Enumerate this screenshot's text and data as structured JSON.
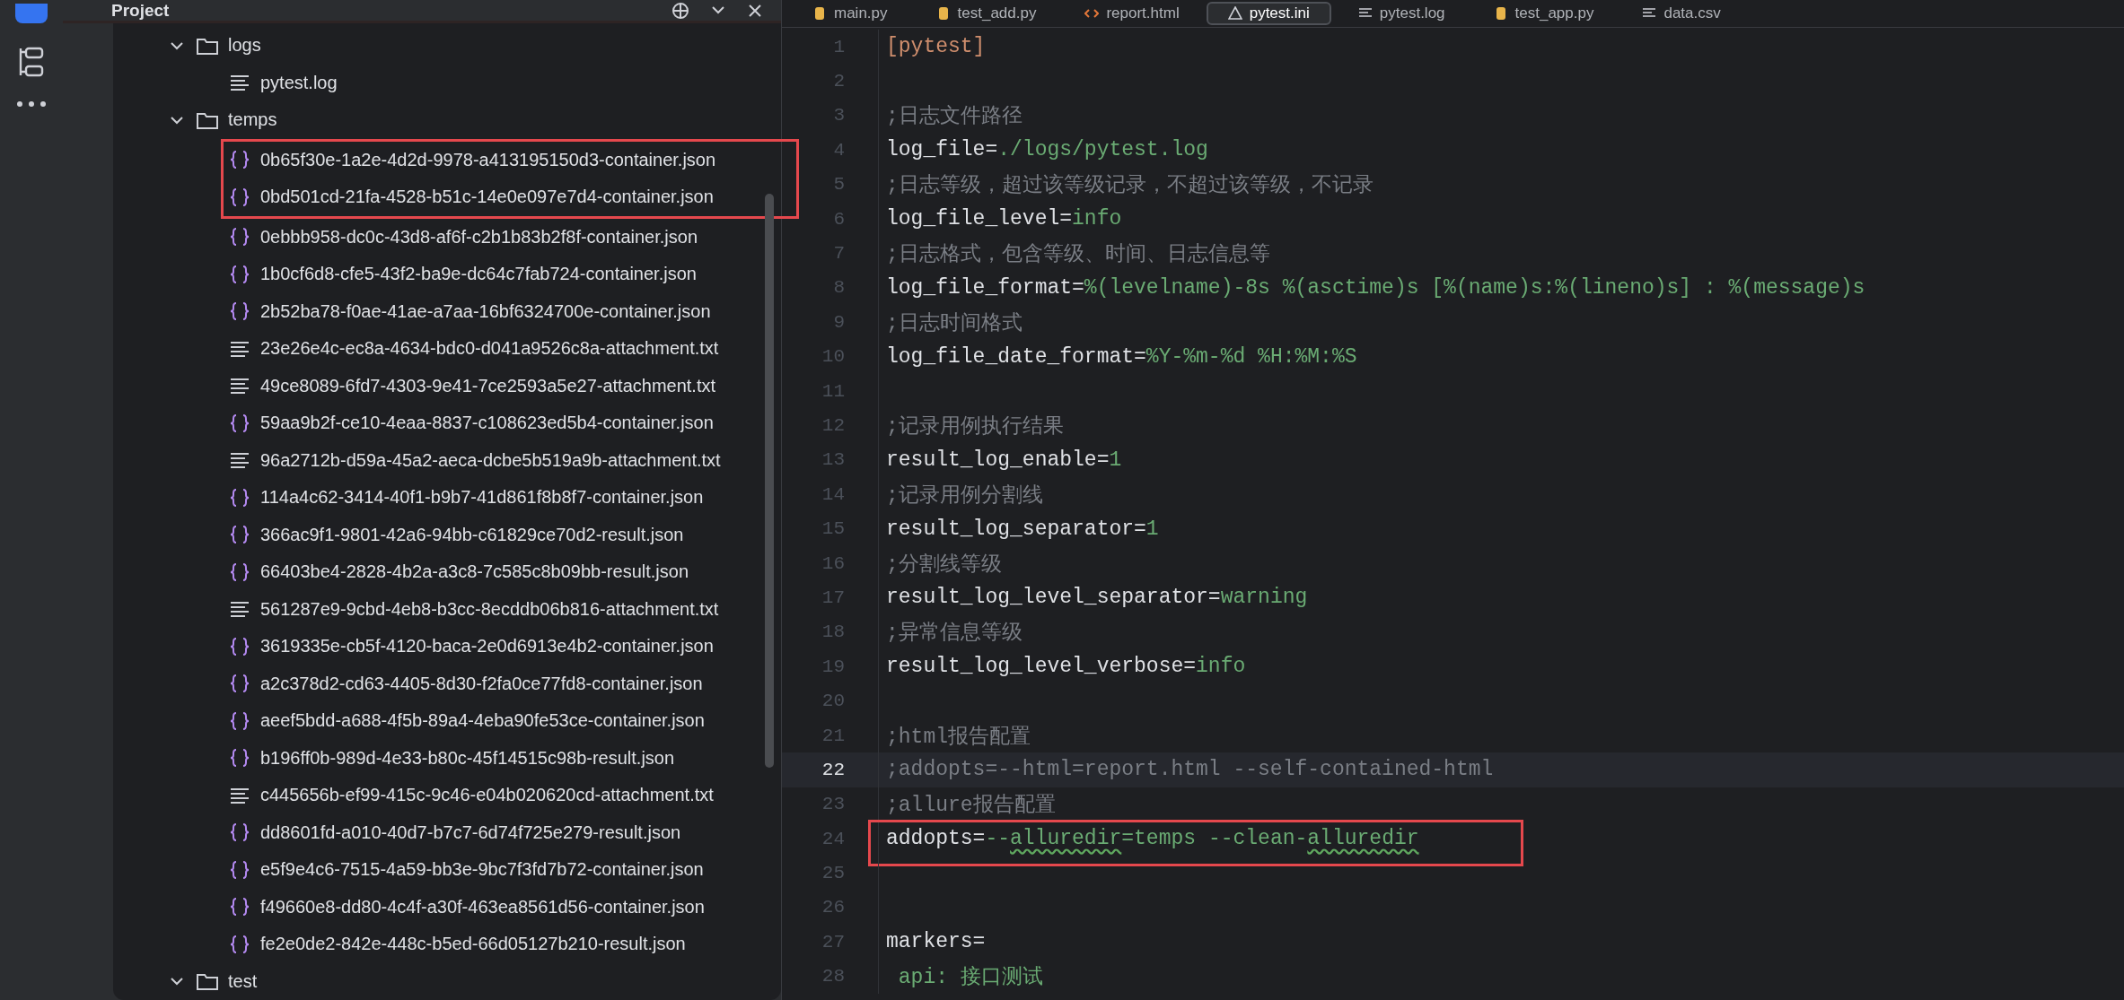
{
  "project_panel": {
    "title": "Project",
    "tree": [
      {
        "name": "logs",
        "kind": "folder",
        "expanded": true,
        "children": [
          {
            "name": "pytest.log",
            "kind": "text",
            "highlighted": false
          }
        ]
      },
      {
        "name": "temps",
        "kind": "folder",
        "expanded": true,
        "children": [
          {
            "name": "0b65f30e-1a2e-4d2d-9978-a413195150d3-container.json",
            "kind": "json",
            "highlighted": true
          },
          {
            "name": "0bd501cd-21fa-4528-b51c-14e0e097e7d4-container.json",
            "kind": "json",
            "highlighted": true
          },
          {
            "name": "0ebbb958-dc0c-43d8-af6f-c2b1b83b2f8f-container.json",
            "kind": "json",
            "highlighted": false
          },
          {
            "name": "1b0cf6d8-cfe5-43f2-ba9e-dc64c7fab724-container.json",
            "kind": "json",
            "highlighted": false
          },
          {
            "name": "2b52ba78-f0ae-41ae-a7aa-16bf6324700e-container.json",
            "kind": "json",
            "highlighted": false
          },
          {
            "name": "23e26e4c-ec8a-4634-bdc0-d041a9526c8a-attachment.txt",
            "kind": "text",
            "highlighted": false
          },
          {
            "name": "49ce8089-6fd7-4303-9e41-7ce2593a5e27-attachment.txt",
            "kind": "text",
            "highlighted": false
          },
          {
            "name": "59aa9b2f-ce10-4eaa-8837-c108623ed5b4-container.json",
            "kind": "json",
            "highlighted": false
          },
          {
            "name": "96a2712b-d59a-45a2-aeca-dcbe5b519a9b-attachment.txt",
            "kind": "text",
            "highlighted": false
          },
          {
            "name": "114a4c62-3414-40f1-b9b7-41d861f8b8f7-container.json",
            "kind": "json",
            "highlighted": false
          },
          {
            "name": "366ac9f1-9801-42a6-94bb-c61829ce70d2-result.json",
            "kind": "json",
            "highlighted": false
          },
          {
            "name": "66403be4-2828-4b2a-a3c8-7c585c8b09bb-result.json",
            "kind": "json",
            "highlighted": false
          },
          {
            "name": "561287e9-9cbd-4eb8-b3cc-8ecddb06b816-attachment.txt",
            "kind": "text",
            "highlighted": false
          },
          {
            "name": "3619335e-cb5f-4120-baca-2e0d6913e4b2-container.json",
            "kind": "json",
            "highlighted": false
          },
          {
            "name": "a2c378d2-cd63-4405-8d30-f2fa0ce77fd8-container.json",
            "kind": "json",
            "highlighted": false
          },
          {
            "name": "aeef5bdd-a688-4f5b-89a4-4eba90fe53ce-container.json",
            "kind": "json",
            "highlighted": false
          },
          {
            "name": "b196ff0b-989d-4e33-b80c-45f14515c98b-result.json",
            "kind": "json",
            "highlighted": false
          },
          {
            "name": "c445656b-ef99-415c-9c46-e04b020620cd-attachment.txt",
            "kind": "text",
            "highlighted": false
          },
          {
            "name": "dd8601fd-a010-40d7-b7c7-6d74f725e279-result.json",
            "kind": "json",
            "highlighted": false
          },
          {
            "name": "e5f9e4c6-7515-4a59-bb3e-9bc7f3fd7b72-container.json",
            "kind": "json",
            "highlighted": false
          },
          {
            "name": "f49660e8-dd80-4c4f-a30f-463ea8561d56-container.json",
            "kind": "json",
            "highlighted": false
          },
          {
            "name": "fe2e0de2-842e-448c-b5ed-66d05127b210-result.json",
            "kind": "json",
            "highlighted": false
          }
        ]
      },
      {
        "name": "test",
        "kind": "folder",
        "expanded": true
      }
    ]
  },
  "editor": {
    "tabs": [
      {
        "label": "main.py",
        "kind": "python",
        "selected": false
      },
      {
        "label": "test_add.py",
        "kind": "python",
        "selected": false
      },
      {
        "label": "report.html",
        "kind": "html",
        "selected": false
      },
      {
        "label": "pytest.ini",
        "kind": "ini",
        "selected": true
      },
      {
        "label": "pytest.log",
        "kind": "text",
        "selected": false
      },
      {
        "label": "test_app.py",
        "kind": "python",
        "selected": false
      },
      {
        "label": "data.csv",
        "kind": "text",
        "selected": false
      }
    ],
    "lines": [
      {
        "number": "1",
        "current": false,
        "highlighted": false,
        "segments": [
          {
            "text": "[pytest]",
            "kind": "section"
          }
        ]
      },
      {
        "number": "2",
        "current": false,
        "highlighted": false
      },
      {
        "number": "3",
        "current": false,
        "highlighted": false,
        "segments": [
          {
            "text": ";日志文件路径",
            "kind": "comment"
          }
        ]
      },
      {
        "number": "4",
        "current": false,
        "highlighted": false,
        "segments": [
          {
            "text": "log_file=",
            "kind": "key"
          },
          {
            "text": "./logs/pytest.log",
            "kind": "value"
          }
        ]
      },
      {
        "number": "5",
        "current": false,
        "highlighted": false,
        "segments": [
          {
            "text": ";日志等级，超过该等级记录，不超过该等级，不记录",
            "kind": "comment"
          }
        ]
      },
      {
        "number": "6",
        "current": false,
        "highlighted": false,
        "segments": [
          {
            "text": "log_file_level=",
            "kind": "key"
          },
          {
            "text": "info",
            "kind": "value"
          }
        ]
      },
      {
        "number": "7",
        "current": false,
        "highlighted": false,
        "segments": [
          {
            "text": ";日志格式，包含等级、时间、日志信息等",
            "kind": "comment"
          }
        ]
      },
      {
        "number": "8",
        "current": false,
        "highlighted": false,
        "segments": [
          {
            "text": "log_file_format=",
            "kind": "key"
          },
          {
            "text": "%(levelname)-8s %(asctime)s [%(name)s:%(lineno)s] : %(message)s",
            "kind": "value"
          }
        ]
      },
      {
        "number": "9",
        "current": false,
        "highlighted": false,
        "segments": [
          {
            "text": ";日志时间格式",
            "kind": "comment"
          }
        ]
      },
      {
        "number": "10",
        "current": false,
        "highlighted": false,
        "segments": [
          {
            "text": "log_file_date_format=",
            "kind": "key"
          },
          {
            "text": "%Y-%m-%d %H:%M:%S",
            "kind": "value"
          }
        ]
      },
      {
        "number": "11",
        "current": false,
        "highlighted": false
      },
      {
        "number": "12",
        "current": false,
        "highlighted": false,
        "segments": [
          {
            "text": ";记录用例执行结果",
            "kind": "comment"
          }
        ]
      },
      {
        "number": "13",
        "current": false,
        "highlighted": false,
        "segments": [
          {
            "text": "result_log_enable=",
            "kind": "key"
          },
          {
            "text": "1",
            "kind": "value"
          }
        ]
      },
      {
        "number": "14",
        "current": false,
        "highlighted": false,
        "segments": [
          {
            "text": ";记录用例分割线",
            "kind": "comment"
          }
        ]
      },
      {
        "number": "15",
        "current": false,
        "highlighted": false,
        "segments": [
          {
            "text": "result_log_separator=",
            "kind": "key"
          },
          {
            "text": "1",
            "kind": "value"
          }
        ]
      },
      {
        "number": "16",
        "current": false,
        "highlighted": false,
        "segments": [
          {
            "text": ";分割线等级",
            "kind": "comment"
          }
        ]
      },
      {
        "number": "17",
        "current": false,
        "highlighted": false,
        "segments": [
          {
            "text": "result_log_level_separator=",
            "kind": "key"
          },
          {
            "text": "warning",
            "kind": "value"
          }
        ]
      },
      {
        "number": "18",
        "current": false,
        "highlighted": false,
        "segments": [
          {
            "text": ";异常信息等级",
            "kind": "comment"
          }
        ]
      },
      {
        "number": "19",
        "current": false,
        "highlighted": false,
        "segments": [
          {
            "text": "result_log_level_verbose=",
            "kind": "key"
          },
          {
            "text": "info",
            "kind": "value"
          }
        ]
      },
      {
        "number": "20",
        "current": false,
        "highlighted": false
      },
      {
        "number": "21",
        "current": false,
        "highlighted": false,
        "segments": [
          {
            "text": ";html报告配置",
            "kind": "comment"
          }
        ]
      },
      {
        "number": "22",
        "current": true,
        "highlighted": false,
        "segments": [
          {
            "text": ";addopts=--html=report.html --self-contained-html",
            "kind": "comment"
          }
        ]
      },
      {
        "number": "23",
        "current": false,
        "highlighted": false,
        "segments": [
          {
            "text": ";allure报告配置",
            "kind": "comment"
          }
        ]
      },
      {
        "number": "24",
        "current": false,
        "highlighted": true,
        "segments": [
          {
            "text": "addopts=",
            "kind": "key"
          },
          {
            "text": "--",
            "kind": "value"
          },
          {
            "text": "alluredir",
            "kind": "typo"
          },
          {
            "text": "=temps --clean-",
            "kind": "value"
          },
          {
            "text": "alluredir",
            "kind": "typo"
          }
        ]
      },
      {
        "number": "25",
        "current": false,
        "highlighted": false
      },
      {
        "number": "26",
        "current": false,
        "highlighted": false
      },
      {
        "number": "27",
        "current": false,
        "highlighted": false,
        "segments": [
          {
            "text": "markers=",
            "kind": "key"
          }
        ]
      },
      {
        "number": "28",
        "current": false,
        "highlighted": false,
        "segments": [
          {
            "text": " api:",
            "kind": "value"
          },
          {
            "text": " 接口测试",
            "kind": "value"
          }
        ]
      }
    ]
  }
}
